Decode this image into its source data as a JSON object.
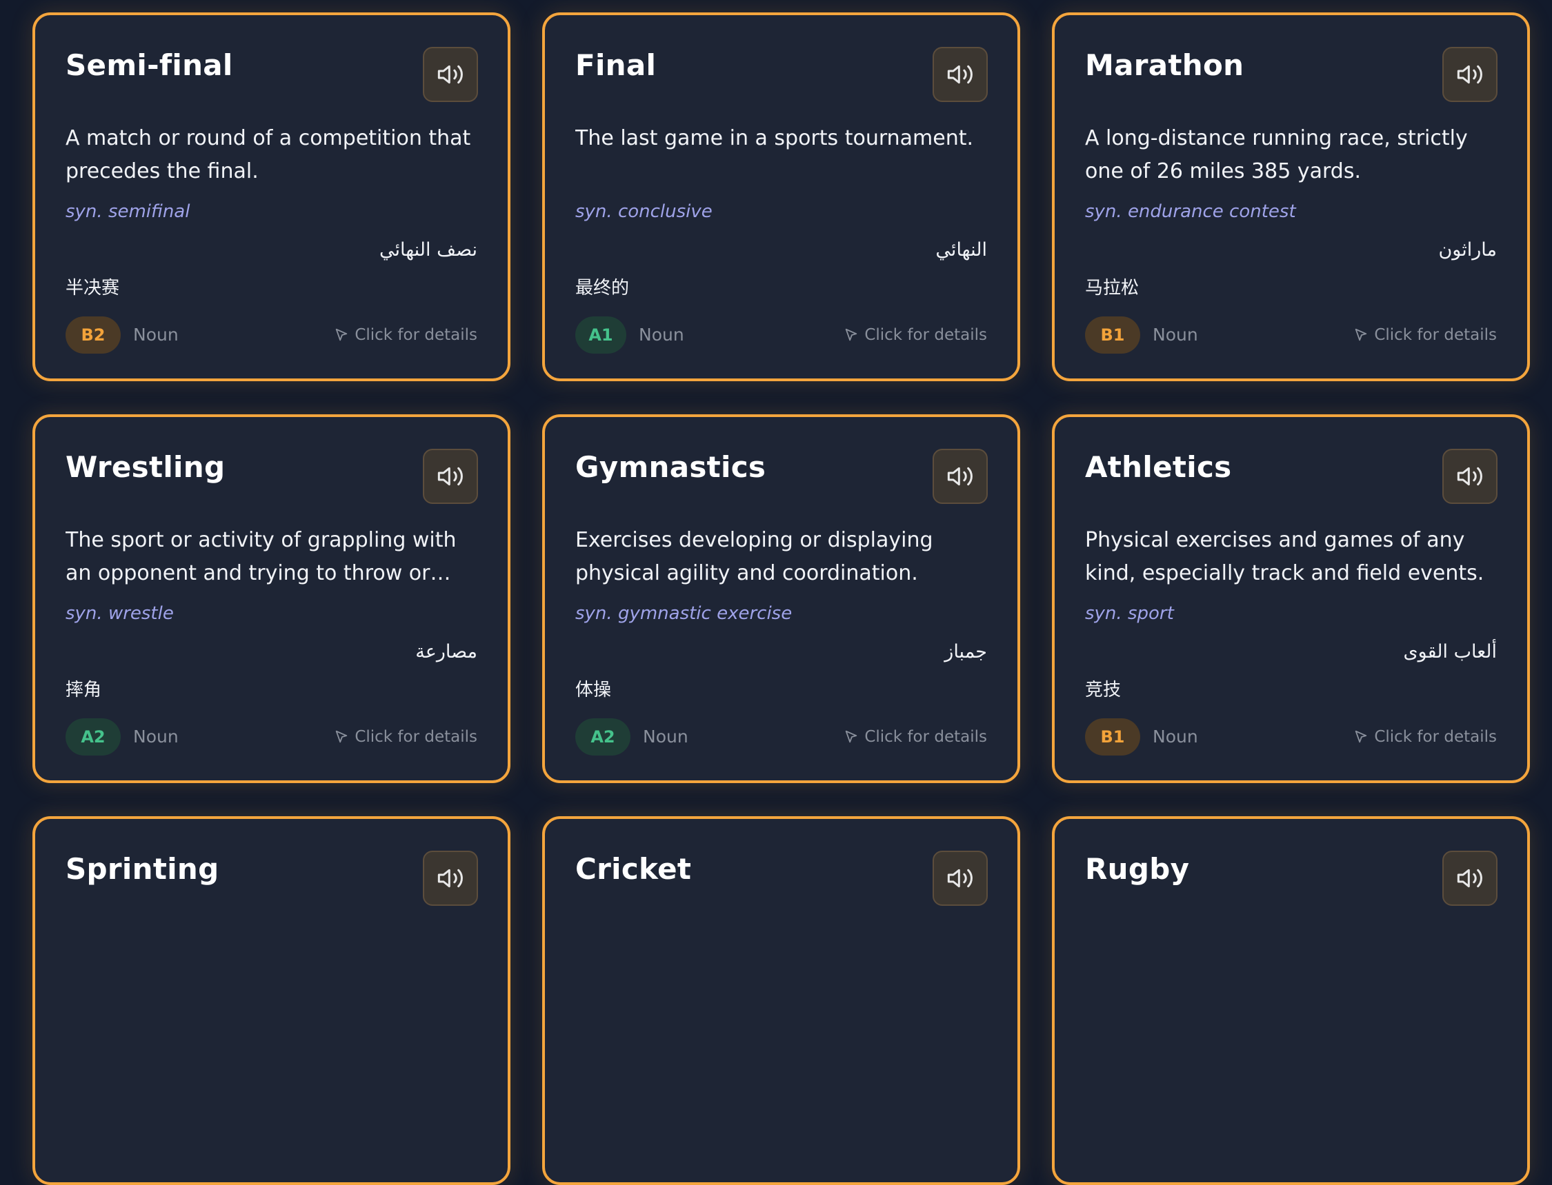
{
  "ui": {
    "details_label": "Click for details",
    "accent_color": "#f4a53d",
    "card_bg": "#1e2535"
  },
  "cards": [
    {
      "word": "Semi-final",
      "definition": "A match or round of a competition that precedes the final.",
      "synonym": "syn. semifinal",
      "arabic": "نصف النهائي",
      "chinese": "半决赛",
      "level": "B2",
      "pos": "Noun"
    },
    {
      "word": "Final",
      "definition": "The last game in a sports tournament.",
      "synonym": "syn. conclusive",
      "arabic": "النهائي",
      "chinese": "最终的",
      "level": "A1",
      "pos": "Noun"
    },
    {
      "word": "Marathon",
      "definition": "A long-distance running race, strictly one of 26 miles 385 yards.",
      "synonym": "syn. endurance contest",
      "arabic": "ماراثون",
      "chinese": "马拉松",
      "level": "B1",
      "pos": "Noun"
    },
    {
      "word": "Wrestling",
      "definition": "The sport or activity of grappling with an opponent and trying to throw or hold ...",
      "synonym": "syn. wrestle",
      "arabic": "مصارعة",
      "chinese": "摔角",
      "level": "A2",
      "pos": "Noun"
    },
    {
      "word": "Gymnastics",
      "definition": "Exercises developing or displaying physical agility and coordination.",
      "synonym": "syn. gymnastic exercise",
      "arabic": "جمباز",
      "chinese": "体操",
      "level": "A2",
      "pos": "Noun"
    },
    {
      "word": "Athletics",
      "definition": "Physical exercises and games of any kind, especially track and field events.",
      "synonym": "syn. sport",
      "arabic": "ألعاب القوى",
      "chinese": "竞技",
      "level": "B1",
      "pos": "Noun"
    },
    {
      "word": "Sprinting"
    },
    {
      "word": "Cricket"
    },
    {
      "word": "Rugby"
    }
  ]
}
